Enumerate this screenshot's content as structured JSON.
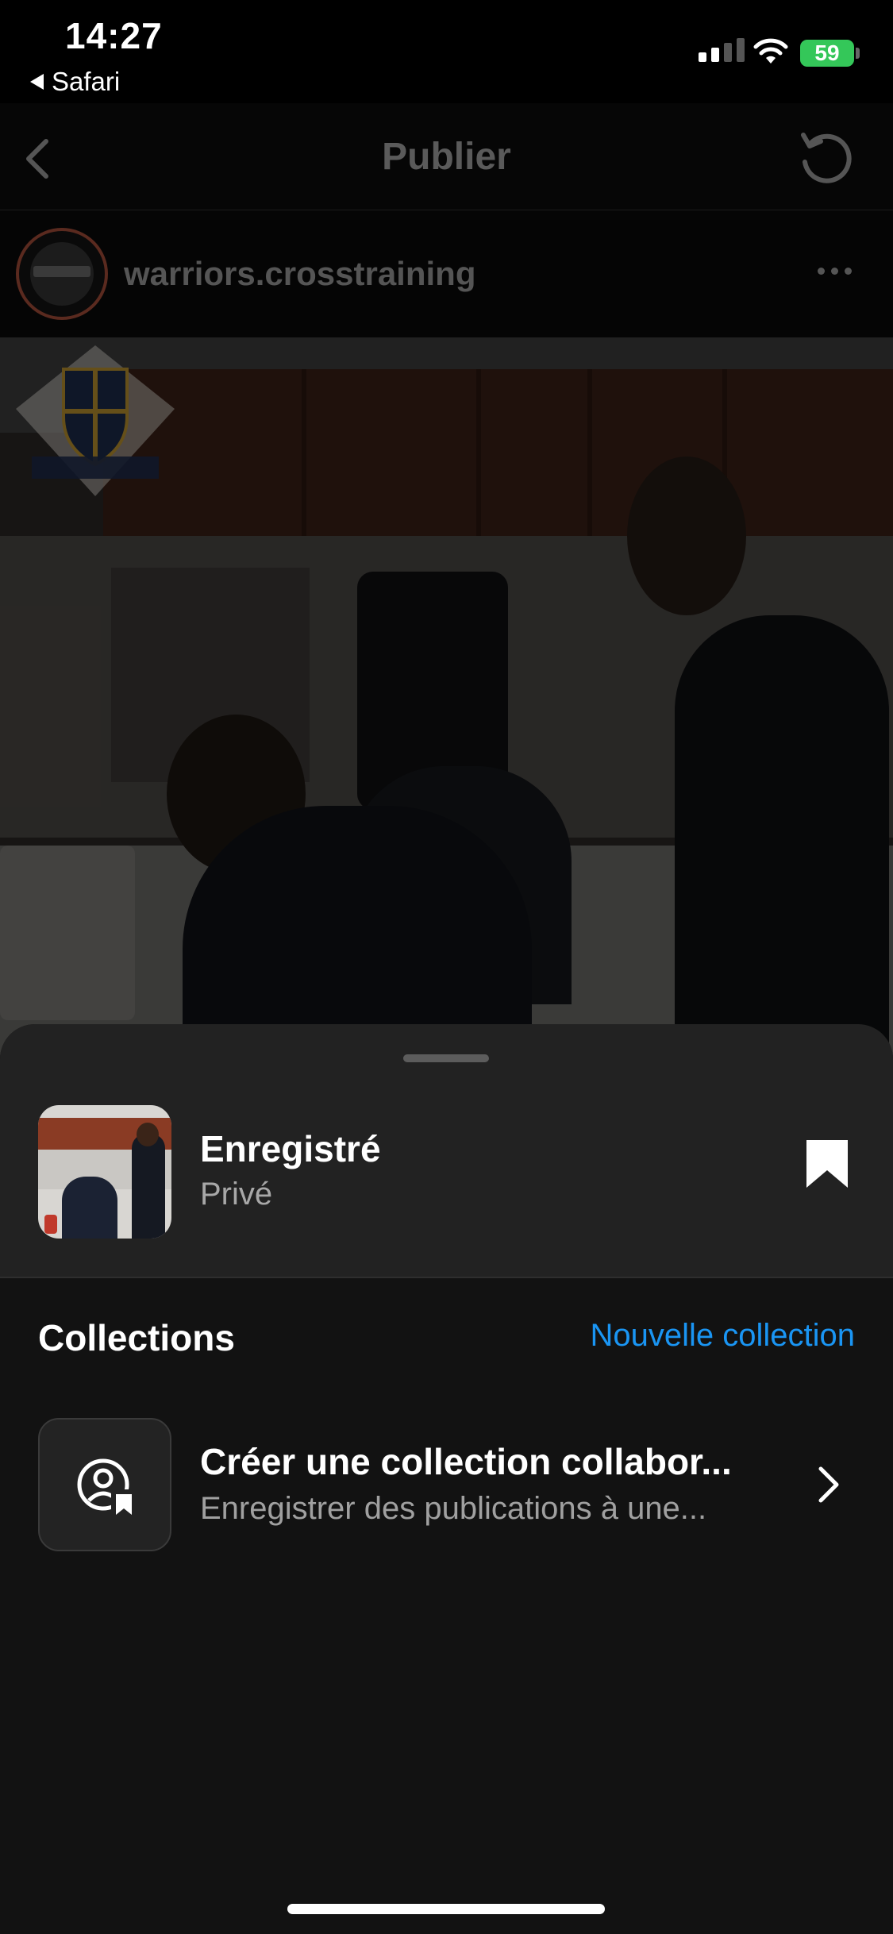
{
  "status_bar": {
    "time": "14:27",
    "back_app": "Safari",
    "battery": "59"
  },
  "header": {
    "title": "Publier",
    "back_icon": "chevron-left-icon",
    "refresh_icon": "refresh-icon"
  },
  "post": {
    "username": "warriors.crosstraining",
    "more_icon": "more-dots-icon"
  },
  "sheet": {
    "saved_title": "Enregistré",
    "saved_subtitle": "Privé",
    "bookmark_icon": "bookmark-filled-icon",
    "collections_title": "Collections",
    "new_collection_label": "Nouvelle collection",
    "collab": {
      "title": "Créer une collection collabor...",
      "subtitle": "Enregistrer des publications à une...",
      "icon": "collab-user-bookmark-icon"
    }
  },
  "colors": {
    "accent": "#1a95f3",
    "sheet_bg": "#121212",
    "sheet_top_bg": "#222222",
    "battery": "#34c759"
  }
}
